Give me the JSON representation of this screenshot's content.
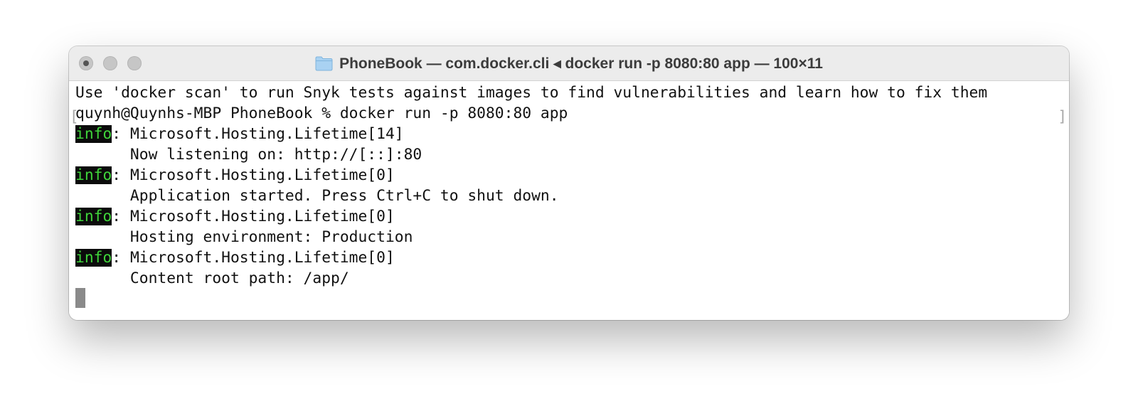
{
  "window": {
    "title": "PhoneBook — com.docker.cli ◂ docker run -p 8080:80 app — 100×11",
    "folder_icon": "folder-icon"
  },
  "terminal": {
    "scan_hint": "Use 'docker scan' to run Snyk tests against images to find vulnerabilities and learn how to fix them",
    "prompt_line": "quynh@Quynhs-MBP PhoneBook % docker run -p 8080:80 app",
    "bracket_left": "[",
    "bracket_right": "]",
    "log_entries": [
      {
        "level": "info",
        "source": ": Microsoft.Hosting.Lifetime[14]",
        "message": "      Now listening on: http://[::]:80"
      },
      {
        "level": "info",
        "source": ": Microsoft.Hosting.Lifetime[0]",
        "message": "      Application started. Press Ctrl+C to shut down."
      },
      {
        "level": "info",
        "source": ": Microsoft.Hosting.Lifetime[0]",
        "message": "      Hosting environment: Production"
      },
      {
        "level": "info",
        "source": ": Microsoft.Hosting.Lifetime[0]",
        "message": "      Content root path: /app/"
      }
    ]
  },
  "colors": {
    "info_badge_bg": "#0b0b0b",
    "info_badge_fg": "#3fd43a",
    "folder_icon": "#8ec2ea"
  }
}
